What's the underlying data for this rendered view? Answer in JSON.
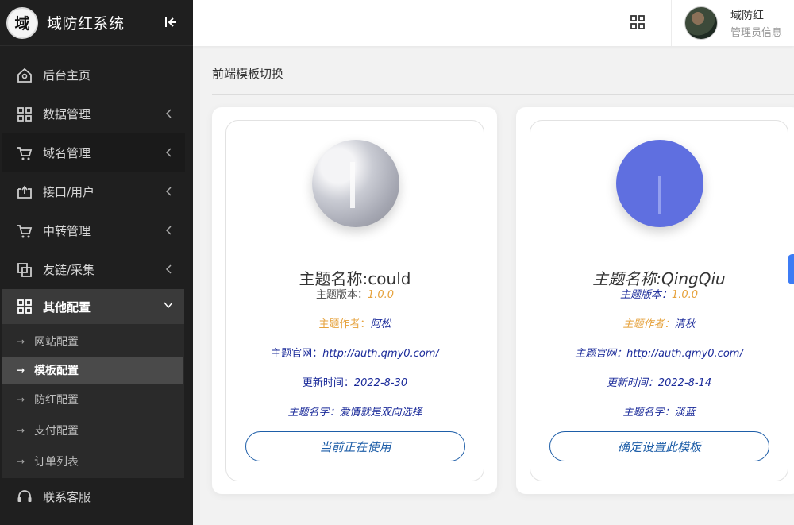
{
  "app": {
    "logo_char": "域",
    "name": "域防红系统"
  },
  "sidebar": {
    "items": [
      {
        "label": "后台主页",
        "icon": "home-icon"
      },
      {
        "label": "数据管理",
        "icon": "grid-icon"
      },
      {
        "label": "域名管理",
        "icon": "cart-icon"
      },
      {
        "label": "接口/用户",
        "icon": "upload-icon"
      },
      {
        "label": "中转管理",
        "icon": "cart-icon"
      },
      {
        "label": "友链/采集",
        "icon": "copy-icon"
      },
      {
        "label": "其他配置",
        "icon": "grid-icon"
      }
    ],
    "submenu": [
      {
        "label": "网站配置"
      },
      {
        "label": "模板配置"
      },
      {
        "label": "防红配置"
      },
      {
        "label": "支付配置"
      },
      {
        "label": "订单列表"
      }
    ],
    "bottom": {
      "label": "联系客服",
      "icon": "headset-icon"
    }
  },
  "header": {
    "user_name": "域防红",
    "user_role": "管理员信息"
  },
  "page": {
    "title": "前端模板切换"
  },
  "themes": [
    {
      "name": "主题名称:could",
      "version_label": "主题版本：",
      "version": "1.0.0",
      "author_label": "主题作者：",
      "author": "阿松",
      "site_label": "主题官网：",
      "site": "http://auth.qmy0.com/",
      "updated_label": "更新时间：",
      "updated": "2022-8-30",
      "alias_label": "主题名字：",
      "alias": "爱情就是双向选择",
      "button": "当前正在使用"
    },
    {
      "name": "主题名称:QingQiu",
      "version_label": "主题版本：",
      "version": "1.0.0",
      "author_label": "主题作者：",
      "author": "清秋",
      "site_label": "主题官网：",
      "site": "http://auth.qmy0.com/",
      "updated_label": "更新时间：",
      "updated": "2022-8-14",
      "alias_label": "主题名字：",
      "alias": "淡蓝",
      "button": "确定设置此模板"
    }
  ],
  "colors": {
    "sidebar_bg": "#1f1f1f",
    "accent_blue": "#1e5ea8",
    "orange": "#e6a23c",
    "theme2_thumb": "#5f6fe0"
  }
}
